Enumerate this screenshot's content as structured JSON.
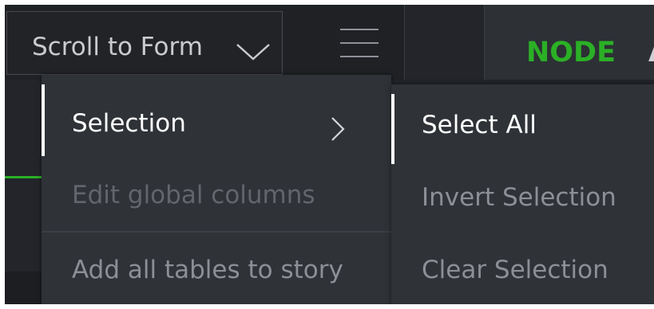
{
  "toolbar": {
    "scroll_dropdown_label": "Scroll to Form",
    "scroll_dropdown_icon": "chevron-down-icon",
    "hamburger_icon": "hamburger-menu-icon",
    "node_tab_label": "NODE",
    "next_tab_partial": "A"
  },
  "primary_menu": {
    "items": [
      {
        "label": "Selection",
        "state": "active",
        "icon": "chevron-right-icon"
      },
      {
        "label": "Edit global columns",
        "state": "disabled"
      },
      {
        "label": "Add all tables to story",
        "state": "normal"
      }
    ]
  },
  "sub_menu": {
    "items": [
      {
        "label": "Select All",
        "state": "active"
      },
      {
        "label": "Invert Selection",
        "state": "normal"
      },
      {
        "label": "Clear Selection",
        "state": "normal"
      }
    ]
  },
  "colors": {
    "background": "#23252a",
    "menu_background": "#2f3237",
    "accent_green": "#2bb026",
    "active_text": "#ffffff",
    "muted_text": "#8c9096",
    "disabled_text": "#62666c"
  }
}
